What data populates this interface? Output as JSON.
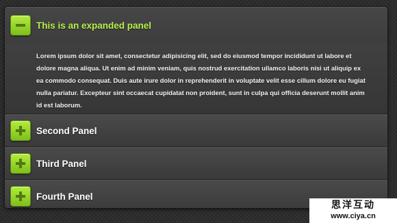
{
  "accordion": {
    "panels": [
      {
        "title": "This is an expanded panel",
        "expanded": true,
        "toggle_icon": "minus-icon",
        "body": "Lorem ipsum dolor sit amet, consectetur adipisicing elit, sed do eiusmod tempor incididunt ut labore et dolore magna aliqua. Ut enim ad minim veniam, quis nostrud exercitation ullamco laboris nisi ut aliquip ex ea commodo consequat. Duis aute irure dolor in reprehenderit in voluptate velit esse cillum dolore eu fugiat nulla pariatur. Excepteur sint occaecat cupidatat non proident, sunt in culpa qui officia deserunt mollit anim id est laborum."
      },
      {
        "title": "Second Panel",
        "expanded": false,
        "toggle_icon": "plus-icon"
      },
      {
        "title": "Third Panel",
        "expanded": false,
        "toggle_icon": "plus-icon"
      },
      {
        "title": "Fourth Panel",
        "expanded": false,
        "toggle_icon": "plus-icon"
      }
    ]
  },
  "watermark": {
    "chinese": "思洋互动",
    "url": "www.ciya.cn"
  },
  "colors": {
    "accent_green": "#9ad32c",
    "expanded_title": "#b7f04a",
    "panel_bg": "#3c3c3c",
    "page_bg": "#2b2b2b"
  }
}
